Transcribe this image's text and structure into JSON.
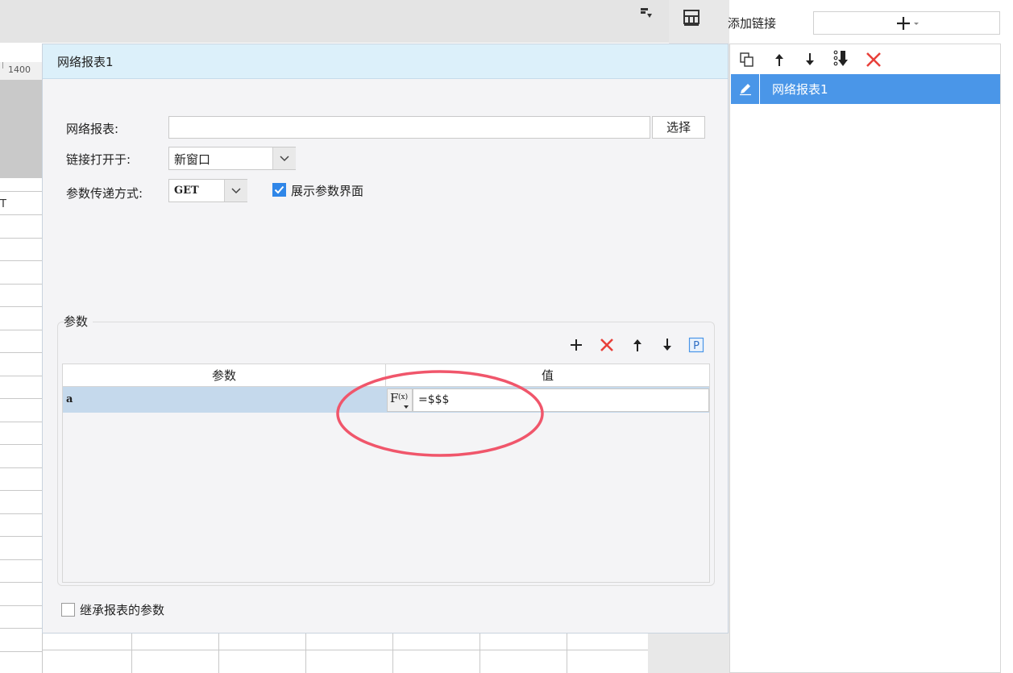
{
  "ruler": {
    "mark": "1400"
  },
  "sheet": {
    "partial_cell_text": "T"
  },
  "dialog": {
    "title": "网络报表1",
    "report_label": "网络报表:",
    "report_value": "",
    "select_label": "选择",
    "open_in_label": "链接打开于:",
    "open_in_value": "新窗口",
    "method_label": "参数传递方式:",
    "method_value": "GET",
    "show_params_label": "展示参数界面",
    "show_params_checked": true,
    "params_group_title": "参数",
    "params_table": {
      "columns": [
        "参数",
        "值"
      ],
      "rows": [
        {
          "name": "a",
          "value": "=$$$"
        }
      ]
    },
    "inherit_label": "继承报表的参数",
    "inherit_checked": false
  },
  "right_panel": {
    "title": "添加链接",
    "links": [
      {
        "label": "网络报表1"
      }
    ]
  },
  "colors": {
    "accent": "#4a96e8",
    "delete": "#e8403a",
    "header_bg": "#dcf0fa",
    "highlight": "#f0566b"
  },
  "icons": [
    "sort-icon",
    "grid-layout-icon",
    "copy-icon",
    "arrow-up-icon",
    "arrow-down-icon",
    "sort-down-icon",
    "delete-icon",
    "add-icon",
    "param-p-icon",
    "edit-icon",
    "chevron-down-icon",
    "fx-icon"
  ]
}
